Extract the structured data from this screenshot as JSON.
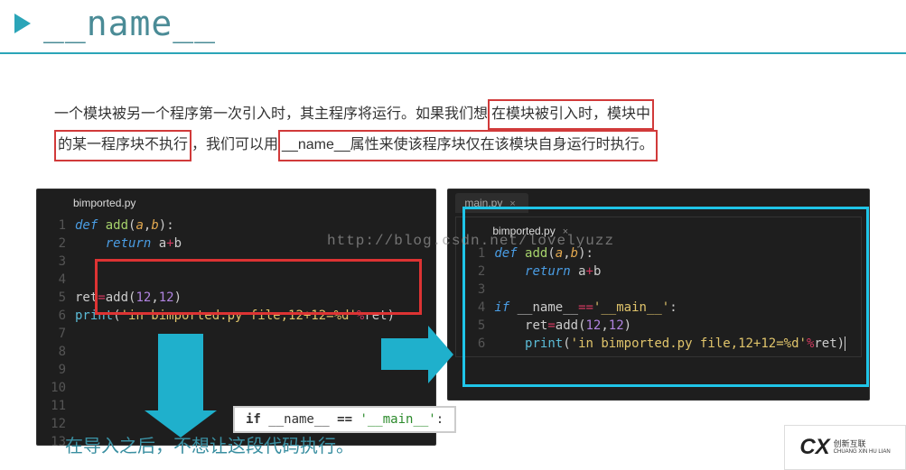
{
  "header": {
    "title": "__name__"
  },
  "para": {
    "t1": "一个模块被另一个程序第一次引入时，其主程序将运行。如果我们想",
    "h1": "在模块被引入时，模块中",
    "h2": "的某一程序块不执行",
    "t2": "，我们可以用",
    "h3": "__name__属性来使该程序块仅在该模块自身运行时执行。"
  },
  "left_editor": {
    "tab": "bimported.py",
    "numbers": [
      "1",
      "2",
      "3",
      "4",
      "5",
      "6",
      "7",
      "8",
      "9",
      "10",
      "11",
      "12",
      "13"
    ],
    "code": {
      "l1a": "def ",
      "l1b": "add",
      "l1c": "(",
      "l1d": "a",
      "l1e": ",",
      "l1f": "b",
      "l1g": "):",
      "l2a": "    ",
      "l2b": "return ",
      "l2c": "a",
      "l2d": "+",
      "l2e": "b",
      "l5a": "ret",
      "l5b": "=",
      "l5c": "add(",
      "l5d": "12",
      "l5e": ",",
      "l5f": "12",
      "l5g": ")",
      "l6a": "print",
      "l6b": "(",
      "l6c": "'in bimported.py file,12+12=%d'",
      "l6d": "%",
      "l6e": "ret)"
    }
  },
  "right_editor": {
    "tab1": "main.py",
    "tab2": "bimported.py",
    "numbers": [
      "1",
      "2",
      "3",
      "4",
      "5",
      "6"
    ],
    "code": {
      "l1a": "def ",
      "l1b": "add",
      "l1c": "(",
      "l1d": "a",
      "l1e": ",",
      "l1f": "b",
      "l1g": "):",
      "l2a": "    ",
      "l2b": "return ",
      "l2c": "a",
      "l2d": "+",
      "l2e": "b",
      "l4a": "if ",
      "l4b": "__name__",
      "l4c": "==",
      "l4d": "'__main__'",
      "l4e": ":",
      "l5a": "    ret",
      "l5b": "=",
      "l5c": "add(",
      "l5d": "12",
      "l5e": ",",
      "l5f": "12",
      "l5g": ")",
      "l6a": "    ",
      "l6b": "print",
      "l6c": "(",
      "l6d": "'in bimported.py file,12+12=%d'",
      "l6e": "%",
      "l6f": "ret)"
    }
  },
  "popup": {
    "t1": "if",
    "t2": "  __name__ ",
    "t3": "==",
    "t4": " '__main__'",
    "t5": ":"
  },
  "bottom_text": "在导入之后，不想让这段代码执行。",
  "watermark": "http://blog.csdn.net/lovelyuzz",
  "logo": {
    "mark": "CX",
    "cn": "创新互联",
    "en": "CHUANG XIN HU LIAN"
  }
}
